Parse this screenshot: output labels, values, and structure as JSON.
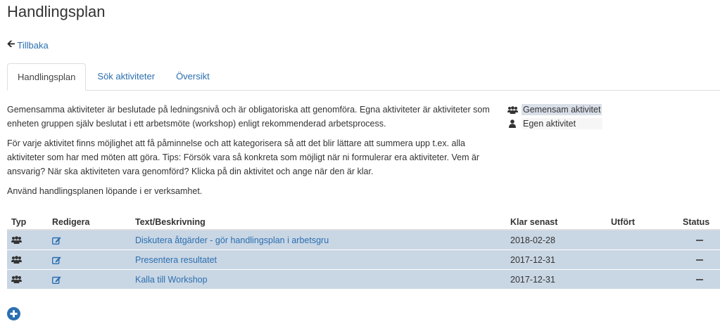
{
  "page": {
    "title": "Handlingsplan",
    "back_label": "Tillbaka"
  },
  "tabs": [
    {
      "label": "Handlingsplan",
      "active": true
    },
    {
      "label": "Sök aktiviteter",
      "active": false
    },
    {
      "label": "Översikt",
      "active": false
    }
  ],
  "intro": {
    "p1": "Gemensamma aktiviteter är beslutade på ledningsnivå och är obligatoriska att genomföra. Egna aktiviteter är aktiviteter som enheten gruppen själv beslutat i ett arbetsmöte (workshop) enligt rekommenderad arbetsprocess.",
    "p2": "För varje aktivitet finns möjlighet att få påminnelse och att kategorisera så att det blir lättare att summera upp t.ex. alla aktiviteter som har med möten att göra. Tips: Försök vara så konkreta som möjligt när ni formulerar era aktiviteter. Vem är ansvarig? När ska aktiviteten vara genomförd? Klicka på din aktivitet och ange när den är klar.",
    "p3": "Använd handlingsplanen löpande i er verksamhet."
  },
  "legend": {
    "common": "Gemensam aktivitet",
    "own": "Egen aktivitet"
  },
  "table": {
    "headers": {
      "typ": "Typ",
      "redigera": "Redigera",
      "text": "Text/Beskrivning",
      "klar": "Klar senast",
      "utfort": "Utfört",
      "status": "Status"
    },
    "rows": [
      {
        "text": "Diskutera åtgärder - gör handlingsplan i arbetsgru",
        "klar": "2018-02-28",
        "utfort": ""
      },
      {
        "text": "Presentera resultatet",
        "klar": "2017-12-31",
        "utfort": ""
      },
      {
        "text": "Kalla till Workshop",
        "klar": "2017-12-31",
        "utfort": ""
      }
    ]
  },
  "colors": {
    "link": "#2a6fb0",
    "row_bg": "#c9d6e4",
    "legend_highlight": "#d9dfe8"
  },
  "icons": {
    "back": "arrow-left-icon",
    "group": "users-icon",
    "user": "user-icon",
    "edit": "edit-icon",
    "status": "minus-icon",
    "add": "plus-circle-icon"
  }
}
